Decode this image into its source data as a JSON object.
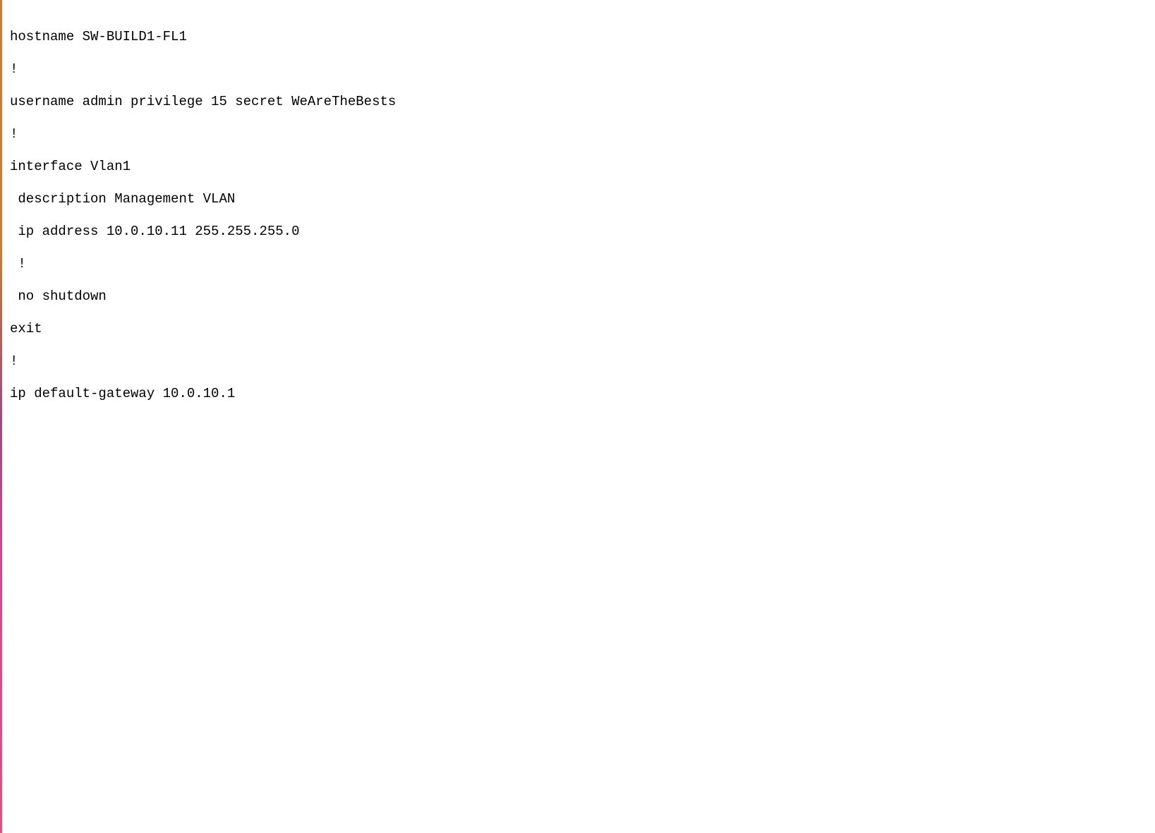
{
  "config": {
    "lines": [
      "hostname SW-BUILD1-FL1",
      "!",
      "username admin privilege 15 secret WeAreTheBests",
      "!",
      "interface Vlan1",
      " description Management VLAN",
      " ip address 10.0.10.11 255.255.255.0",
      " !",
      " no shutdown",
      "exit",
      "!",
      "ip default-gateway 10.0.10.1"
    ]
  }
}
